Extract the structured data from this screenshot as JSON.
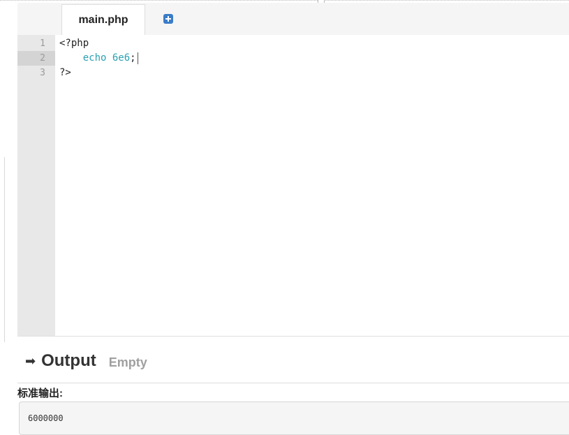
{
  "editor": {
    "tabs": [
      {
        "label": "main.php"
      }
    ],
    "add_tab_icon": "plus-square-icon",
    "lines": [
      {
        "num": "1",
        "text": "<?php"
      },
      {
        "num": "2",
        "keyword": "echo 6e6",
        "text": ";"
      },
      {
        "num": "3",
        "text": "?>"
      }
    ],
    "active_line": "2"
  },
  "output": {
    "icon": "sign-out-arrow-icon",
    "title": "Output",
    "status": "Empty",
    "stdout_label": "标准输出:",
    "stdout_value": "6000000"
  },
  "colors": {
    "keyword": "#2aa1b3",
    "add_button": "#3a7cc8",
    "gutter": "#e8e8e8",
    "active_gutter": "#d4d4d4"
  }
}
